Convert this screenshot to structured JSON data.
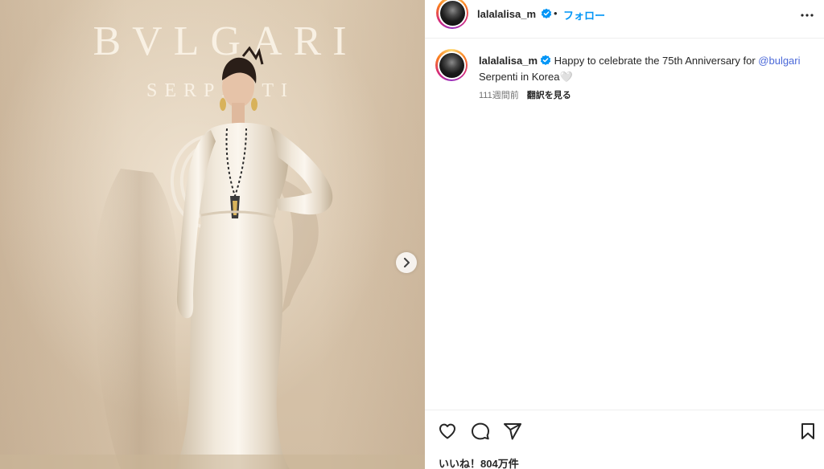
{
  "post": {
    "username": "lalalalisa_m",
    "dot": "•",
    "follow_label": "フォロー",
    "media": {
      "brand_main": "BVLGARI",
      "brand_sub": "SERPENTI"
    },
    "caption": {
      "text_before": "Happy to celebrate the 75th Anniversary for ",
      "mention": "@bulgari",
      "text_after": " Serpenti in Korea",
      "emoji": "🤍"
    },
    "timestamp": "111週間前",
    "translate_label": "翻訳を見る",
    "likes": "いいね！804万件"
  },
  "icons": {
    "verified": "verified-badge-icon",
    "more": "more-horizontal-icon",
    "like": "heart-icon",
    "comment": "comment-bubble-icon",
    "share": "paper-plane-icon",
    "save": "bookmark-icon",
    "next": "chevron-right-icon"
  },
  "colors": {
    "accent": "#0095f6",
    "verified": "#0095f6",
    "mention": "#4a68d8",
    "muted": "#737373"
  }
}
